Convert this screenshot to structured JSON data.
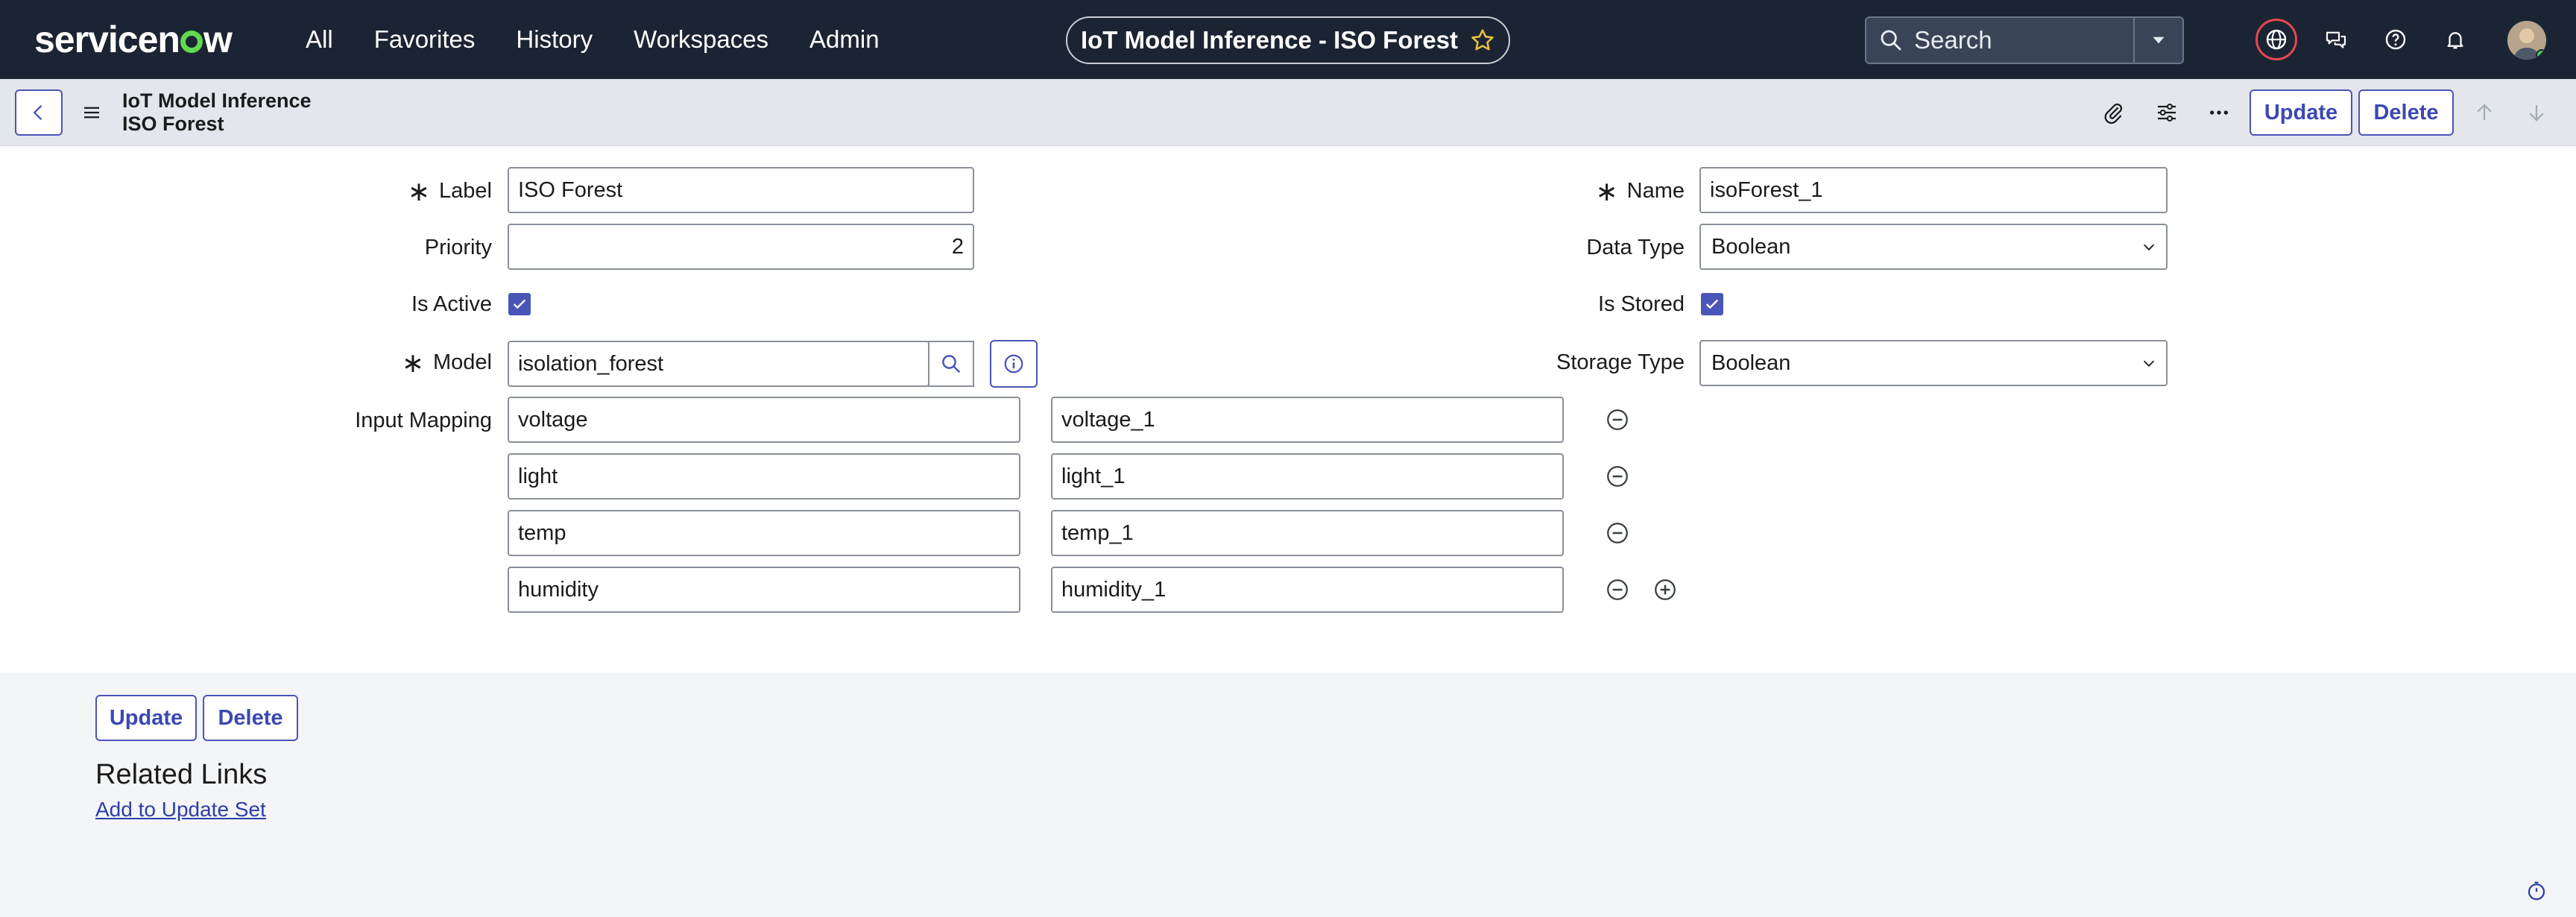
{
  "nav": {
    "logo": "servicenow",
    "menu": [
      "All",
      "Favorites",
      "History",
      "Workspaces",
      "Admin"
    ],
    "title": "IoT Model Inference - ISO Forest",
    "search_placeholder": "Search",
    "icons": [
      "globe-icon",
      "chat-icon",
      "help-icon",
      "bell-icon"
    ]
  },
  "record": {
    "title_line1": "IoT Model Inference",
    "title_line2": "ISO Forest",
    "update_label": "Update",
    "delete_label": "Delete",
    "header_icons": [
      "paperclip-icon",
      "settings-sliders-icon",
      "more-icon",
      "arrow-up-icon",
      "arrow-down-icon"
    ]
  },
  "form": {
    "label": {
      "label": "Label",
      "value": "ISO Forest",
      "required": true
    },
    "priority": {
      "label": "Priority",
      "value": "2"
    },
    "is_active": {
      "label": "Is Active",
      "checked": true
    },
    "model": {
      "label": "Model",
      "value": "isolation_forest",
      "required": true
    },
    "name": {
      "label": "Name",
      "value": "isoForest_1",
      "required": true
    },
    "data_type": {
      "label": "Data Type",
      "value": "Boolean"
    },
    "is_stored": {
      "label": "Is Stored",
      "checked": true
    },
    "storage_type": {
      "label": "Storage Type",
      "value": "Boolean"
    },
    "input_mapping": {
      "label": "Input Mapping",
      "rows": [
        {
          "input": "voltage",
          "output": "voltage_1"
        },
        {
          "input": "light",
          "output": "light_1"
        },
        {
          "input": "temp",
          "output": "temp_1"
        },
        {
          "input": "humidity",
          "output": "humidity_1"
        }
      ]
    }
  },
  "footer": {
    "update_label": "Update",
    "delete_label": "Delete",
    "related_title": "Related Links",
    "related_link": "Add to Update Set"
  },
  "colors": {
    "nav_bg": "#1b2432",
    "accent": "#4a55b8",
    "logo_green": "#62d84e",
    "globe_ring": "#e5484d"
  }
}
